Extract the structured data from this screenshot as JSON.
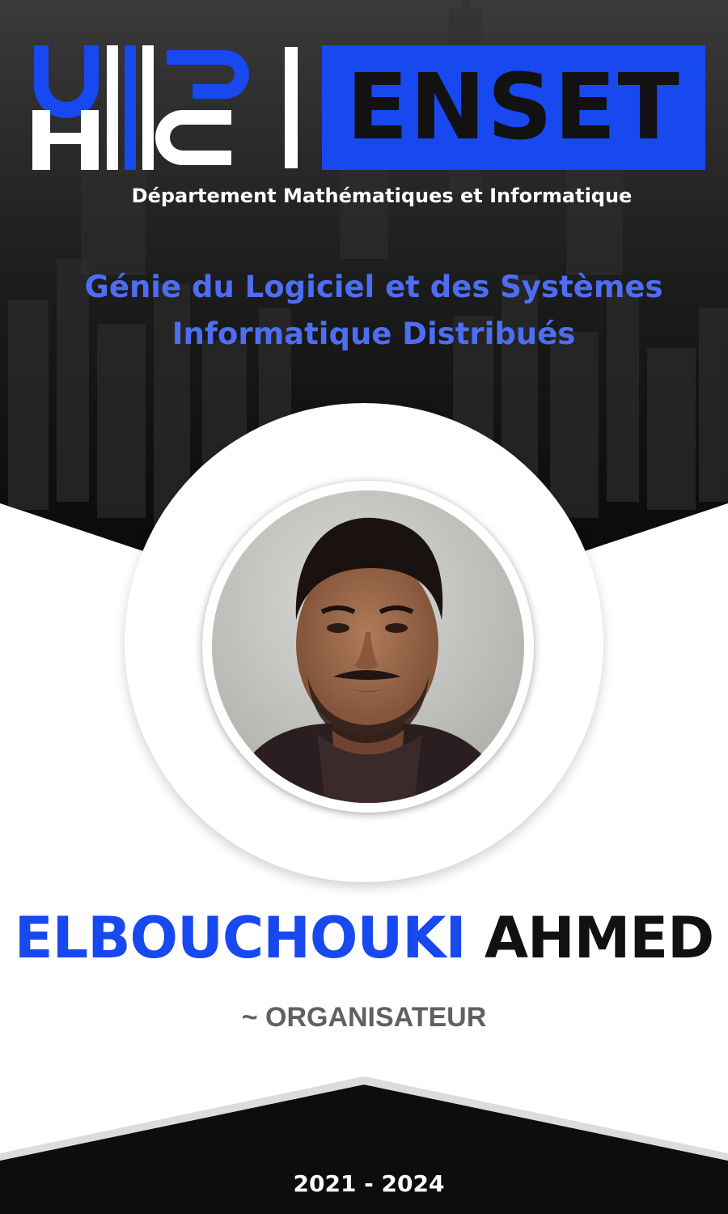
{
  "logo": {
    "left_mark": "uh2c-monogram",
    "name": "ENSET"
  },
  "department": "Département Mathématiques et Informatique",
  "program": {
    "line1": "Génie du Logiciel et des Systèmes",
    "line2": "Informatique Distribués"
  },
  "person": {
    "last_name": "ELBOUCHOUKI",
    "first_name": "AHMED",
    "photo_icon": "profile-photo"
  },
  "role": "~ ORGANISATEUR",
  "years": "2021 - 2024",
  "colors": {
    "accent_blue": "#1748f0",
    "program_blue": "#4d6ef2",
    "dark": "#0b0b0b",
    "role_gray": "#616161"
  }
}
